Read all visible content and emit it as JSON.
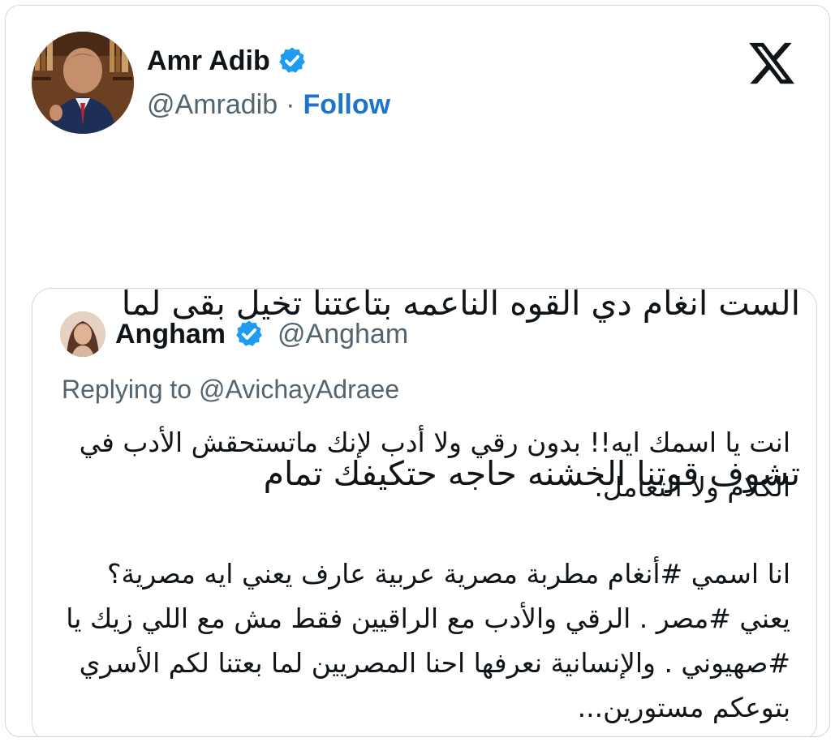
{
  "author": {
    "name": "Amr Adib",
    "handle": "@Amradib",
    "separator": "·",
    "follow_label": "Follow",
    "verified_icon": "verified-badge-icon"
  },
  "platform": {
    "logo_icon": "x-logo-icon"
  },
  "tweet": {
    "line1": "الست انغام دي القوه الناعمه بتاعتنا تخيل بقى لما",
    "line2": "تشوف قوتنا الخشنه حاجه حتكيفك تمام"
  },
  "quoted": {
    "name": "Angham",
    "handle": "@Angham",
    "replying_to": "Replying to @AvichayAdraee",
    "paragraph1": "انت يا اسمك ايه!! بدون رقي ولا أدب لإنك ماتستحقش الأدب في الكلام ولا التعامل.",
    "paragraph2": "انا اسمي #أنغام مطربة مصرية عربية عارف يعني ايه مصرية؟ يعني #مصر . الرقي والأدب مع الراقيين فقط مش مع اللي زيك يا #صهيوني . والإنسانية نعرفها احنا المصريين لما بعتنا لكم الأسري بتوعكم مستورين..."
  },
  "colors": {
    "verified": "#1d9bf0",
    "follow": "#1d74c9",
    "secondary_text": "#536471",
    "border": "#cfd9de"
  }
}
